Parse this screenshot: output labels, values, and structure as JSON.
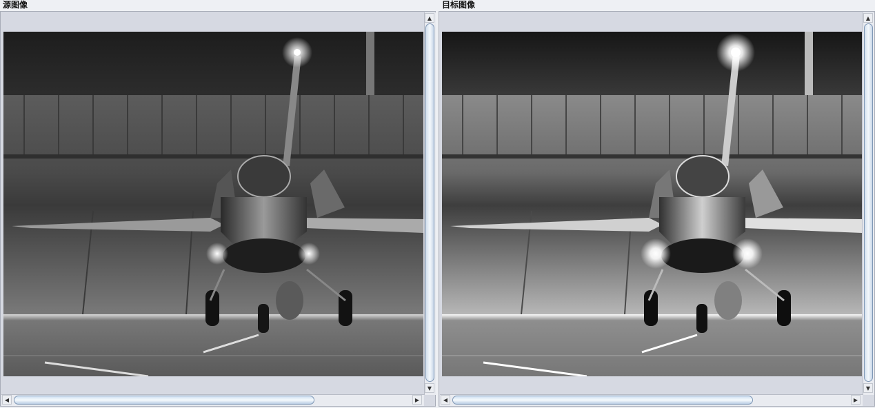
{
  "source": {
    "title": "源图像"
  },
  "target": {
    "title": "目标图像"
  },
  "image_description": "",
  "colors": {
    "pane_bg": "#d6d9e2",
    "thumb_border": "#7f97b5",
    "window_bg": "#eef0f4"
  },
  "icons": {
    "up": "scroll-up-arrow-icon",
    "down": "scroll-down-arrow-icon",
    "left": "scroll-left-arrow-icon",
    "right": "scroll-right-arrow-icon"
  }
}
